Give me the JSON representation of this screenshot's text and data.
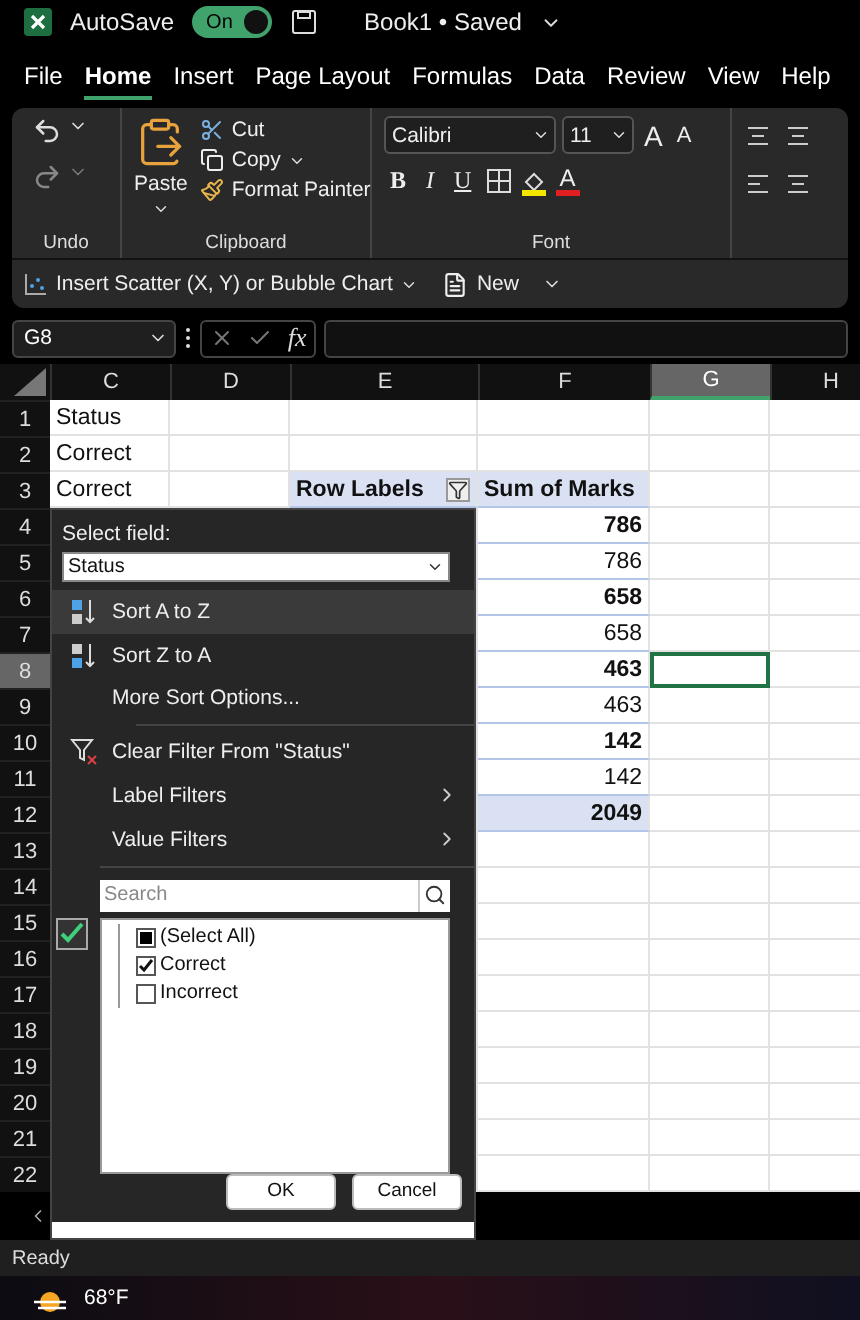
{
  "title_bar": {
    "autosave_label": "AutoSave",
    "autosave": {
      "on": true,
      "state_text": "On"
    },
    "document_title": "Book1 • Saved"
  },
  "menu_tabs": [
    {
      "label": "File",
      "selected": false
    },
    {
      "label": "Home",
      "selected": true
    },
    {
      "label": "Insert",
      "selected": false
    },
    {
      "label": "Page Layout",
      "selected": false
    },
    {
      "label": "Formulas",
      "selected": false
    },
    {
      "label": "Data",
      "selected": false
    },
    {
      "label": "Review",
      "selected": false
    },
    {
      "label": "View",
      "selected": false
    },
    {
      "label": "Help",
      "selected": false
    }
  ],
  "ribbon": {
    "undo_label": "Undo",
    "clipboard": {
      "paste": "Paste",
      "cut": "Cut",
      "copy": "Copy",
      "format_painter": "Format Painter",
      "label": "Clipboard"
    },
    "font": {
      "name": "Calibri",
      "size": "11",
      "grow": "A",
      "shrink": "A",
      "bold": "B",
      "italic": "I",
      "underline": "U",
      "font_color": "A",
      "label": "Font"
    }
  },
  "quick_bar": {
    "scatter": "Insert Scatter (X, Y) or Bubble Chart",
    "new": "New"
  },
  "formula_bar": {
    "name_box": "G8",
    "fx": "fx"
  },
  "columns": [
    {
      "label": "C",
      "selected": false
    },
    {
      "label": "D",
      "selected": false
    },
    {
      "label": "E",
      "selected": false
    },
    {
      "label": "F",
      "selected": false
    },
    {
      "label": "G",
      "selected": true
    },
    {
      "label": "H",
      "selected": false
    }
  ],
  "rows": [
    {
      "number": "1",
      "selected": false,
      "kind": "plain",
      "c": "Status"
    },
    {
      "number": "2",
      "selected": false,
      "kind": "plain",
      "c": "Correct"
    },
    {
      "number": "3",
      "selected": false,
      "kind": "header",
      "c": "Correct",
      "e": "Row Labels",
      "f": "Sum of Marks"
    },
    {
      "number": "4",
      "selected": false,
      "kind": "pivot",
      "f": "786",
      "bold": true
    },
    {
      "number": "5",
      "selected": false,
      "kind": "pivot",
      "f": "786",
      "bold": false
    },
    {
      "number": "6",
      "selected": false,
      "kind": "pivot",
      "f": "658",
      "bold": true
    },
    {
      "number": "7",
      "selected": false,
      "kind": "pivot",
      "f": "658",
      "bold": false
    },
    {
      "number": "8",
      "selected": true,
      "kind": "pivot",
      "f": "463",
      "bold": true
    },
    {
      "number": "9",
      "selected": false,
      "kind": "pivot",
      "f": "463",
      "bold": false
    },
    {
      "number": "10",
      "selected": false,
      "kind": "pivot",
      "f": "142",
      "bold": true
    },
    {
      "number": "11",
      "selected": false,
      "kind": "pivot",
      "f": "142",
      "bold": false
    },
    {
      "number": "12",
      "selected": false,
      "kind": "total",
      "f": "2049",
      "bold": true
    },
    {
      "number": "13",
      "selected": false,
      "kind": "plain"
    },
    {
      "number": "14",
      "selected": false,
      "kind": "plain"
    },
    {
      "number": "15",
      "selected": false,
      "kind": "plain"
    },
    {
      "number": "16",
      "selected": false,
      "kind": "plain"
    },
    {
      "number": "17",
      "selected": false,
      "kind": "plain"
    },
    {
      "number": "18",
      "selected": false,
      "kind": "plain"
    },
    {
      "number": "19",
      "selected": false,
      "kind": "plain"
    },
    {
      "number": "20",
      "selected": false,
      "kind": "plain"
    },
    {
      "number": "21",
      "selected": false,
      "kind": "plain"
    },
    {
      "number": "22",
      "selected": false,
      "kind": "plain"
    }
  ],
  "filter_popup": {
    "select_field_label": "Select field:",
    "field_value": "Status",
    "menu": [
      {
        "kind": "sort_az",
        "label": "Sort A to Z",
        "highlighted": true
      },
      {
        "kind": "sort_za",
        "label": "Sort Z to A",
        "highlighted": false
      },
      {
        "kind": "plain",
        "label": "More Sort Options...",
        "highlighted": false
      },
      {
        "kind": "clear",
        "label": "Clear Filter From \"Status\"",
        "highlighted": false
      },
      {
        "kind": "submenu",
        "label": "Label Filters",
        "highlighted": false
      },
      {
        "kind": "submenu",
        "label": "Value Filters",
        "highlighted": false
      }
    ],
    "multi_select": {
      "checked": true
    },
    "search_placeholder": "Search",
    "items": [
      {
        "label": "(Select All)",
        "checked": false,
        "partial": true
      },
      {
        "label": "Correct",
        "checked": true,
        "partial": false
      },
      {
        "label": "Incorrect",
        "checked": false,
        "partial": false
      }
    ],
    "buttons": [
      "OK",
      "Cancel"
    ]
  },
  "status_bar": {
    "text": "Ready"
  },
  "taskbar": {
    "weather": "68°F"
  }
}
